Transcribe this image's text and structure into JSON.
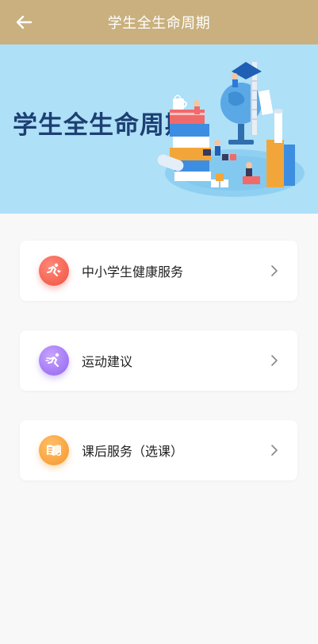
{
  "header": {
    "title": "学生全生命周期",
    "background": "#c9b07e"
  },
  "banner": {
    "title": "学生全生命周期",
    "background": "#aee0f7",
    "title_color": "#1d3f73"
  },
  "menu": {
    "items": [
      {
        "label": "中小学生健康服务",
        "icon": "health-runner-icon",
        "color": "#f0503f"
      },
      {
        "label": "运动建议",
        "icon": "sport-runner-icon",
        "color": "#8f63ef"
      },
      {
        "label": "课后服务（选课）",
        "icon": "book-icon",
        "color": "#f5952a"
      }
    ]
  }
}
